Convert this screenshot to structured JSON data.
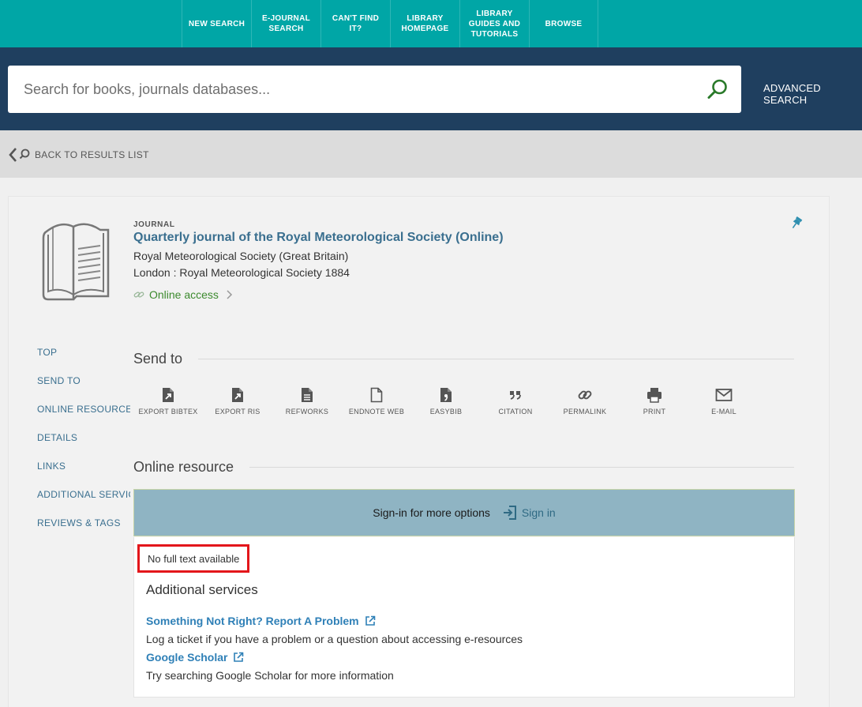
{
  "topnav": {
    "items": [
      {
        "label": "NEW SEARCH"
      },
      {
        "label": "E-JOURNAL SEARCH"
      },
      {
        "label": "CAN'T FIND IT?"
      },
      {
        "label": "LIBRARY HOMEPAGE"
      },
      {
        "label": "LIBRARY GUIDES AND TUTORIALS"
      },
      {
        "label": "BROWSE"
      }
    ]
  },
  "search": {
    "placeholder": "Search for books, journals databases...",
    "value": "",
    "advanced_label": "ADVANCED SEARCH"
  },
  "back": {
    "label": "BACK TO RESULTS LIST"
  },
  "record": {
    "type": "JOURNAL",
    "title": "Quarterly journal of the Royal Meteorological Society (Online)",
    "publisher": "Royal Meteorological Society (Great Britain)",
    "place": "London : Royal Meteorological Society 1884",
    "access": "Online access"
  },
  "sidenav": {
    "items": [
      {
        "label": "TOP"
      },
      {
        "label": "SEND TO"
      },
      {
        "label": "ONLINE RESOURCE"
      },
      {
        "label": "DETAILS"
      },
      {
        "label": "LINKS"
      },
      {
        "label": "ADDITIONAL SERVICES"
      },
      {
        "label": "REVIEWS & TAGS"
      }
    ]
  },
  "sendto": {
    "heading": "Send to",
    "items": [
      {
        "label": "EXPORT BIBTEX",
        "icon": "export-bibtex-icon"
      },
      {
        "label": "EXPORT RIS",
        "icon": "export-ris-icon"
      },
      {
        "label": "REFWORKS",
        "icon": "document-icon"
      },
      {
        "label": "ENDNOTE WEB",
        "icon": "file-icon"
      },
      {
        "label": "EASYBIB",
        "icon": "easybib-icon"
      },
      {
        "label": "CITATION",
        "icon": "quote-icon"
      },
      {
        "label": "PERMALINK",
        "icon": "link-icon"
      },
      {
        "label": "PRINT",
        "icon": "printer-icon"
      },
      {
        "label": "E-MAIL",
        "icon": "mail-icon"
      }
    ]
  },
  "online": {
    "heading": "Online resource",
    "signin_text": "Sign-in for more options",
    "signin_button": "Sign in",
    "no_full_text": "No full text available",
    "additional_heading": "Additional services",
    "services": [
      {
        "label": "Something Not Right? Report A Problem",
        "desc": "Log a ticket if you have a problem or a question about accessing e-resources"
      },
      {
        "label": "Google Scholar",
        "desc": "Try searching Google Scholar for more information"
      }
    ]
  },
  "colors": {
    "topnav_bg": "#00a6a6",
    "search_band_bg": "#1f3f5f",
    "link_blue": "#2f80b7",
    "access_green": "#3c8a2e",
    "highlight_red": "#e3161b"
  }
}
